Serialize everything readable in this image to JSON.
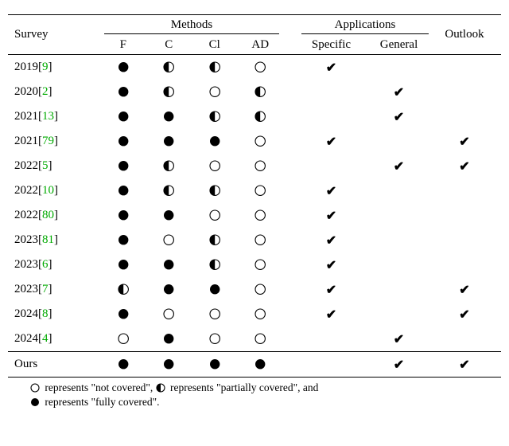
{
  "header": {
    "survey": "Survey",
    "methods_group": "Methods",
    "apps_group": "Applications",
    "outlook": "Outlook",
    "method_cols": [
      "F",
      "C",
      "Cl",
      "AD"
    ],
    "app_cols": [
      "Specific",
      "General"
    ]
  },
  "chart_data": {
    "type": "table",
    "legend": {
      "empty": "not covered",
      "half": "partially covered",
      "full": "fully covered"
    },
    "rows": [
      {
        "year": "2019",
        "ref": "9",
        "methods": [
          "full",
          "half",
          "half",
          "empty"
        ],
        "specific": true,
        "general": false,
        "outlook": false
      },
      {
        "year": "2020",
        "ref": "2",
        "methods": [
          "full",
          "half",
          "empty",
          "half"
        ],
        "specific": false,
        "general": true,
        "outlook": false
      },
      {
        "year": "2021",
        "ref": "13",
        "methods": [
          "full",
          "full",
          "half",
          "half"
        ],
        "specific": false,
        "general": true,
        "outlook": false
      },
      {
        "year": "2021",
        "ref": "79",
        "methods": [
          "full",
          "full",
          "full",
          "empty"
        ],
        "specific": true,
        "general": false,
        "outlook": true
      },
      {
        "year": "2022",
        "ref": "5",
        "methods": [
          "full",
          "half",
          "empty",
          "empty"
        ],
        "specific": false,
        "general": true,
        "outlook": true
      },
      {
        "year": "2022",
        "ref": "10",
        "methods": [
          "full",
          "half",
          "half",
          "empty"
        ],
        "specific": true,
        "general": false,
        "outlook": false
      },
      {
        "year": "2022",
        "ref": "80",
        "methods": [
          "full",
          "full",
          "empty",
          "empty"
        ],
        "specific": true,
        "general": false,
        "outlook": false
      },
      {
        "year": "2023",
        "ref": "81",
        "methods": [
          "full",
          "empty",
          "half",
          "empty"
        ],
        "specific": true,
        "general": false,
        "outlook": false
      },
      {
        "year": "2023",
        "ref": "6",
        "methods": [
          "full",
          "full",
          "half",
          "empty"
        ],
        "specific": true,
        "general": false,
        "outlook": false
      },
      {
        "year": "2023",
        "ref": "7",
        "methods": [
          "half",
          "full",
          "full",
          "empty"
        ],
        "specific": true,
        "general": false,
        "outlook": true
      },
      {
        "year": "2024",
        "ref": "8",
        "methods": [
          "full",
          "empty",
          "empty",
          "empty"
        ],
        "specific": true,
        "general": false,
        "outlook": true
      },
      {
        "year": "2024",
        "ref": "4",
        "methods": [
          "empty",
          "full",
          "empty",
          "empty"
        ],
        "specific": false,
        "general": true,
        "outlook": false
      }
    ],
    "ours": {
      "label": "Ours",
      "methods": [
        "full",
        "full",
        "full",
        "full"
      ],
      "specific": false,
      "general": true,
      "outlook": true
    }
  },
  "caption": {
    "t1": " represents \"not covered\", ",
    "t2": " represents \"partially covered\", and ",
    "t3": " represents \"fully covered\"."
  },
  "glyphs": {
    "check": "✔"
  }
}
